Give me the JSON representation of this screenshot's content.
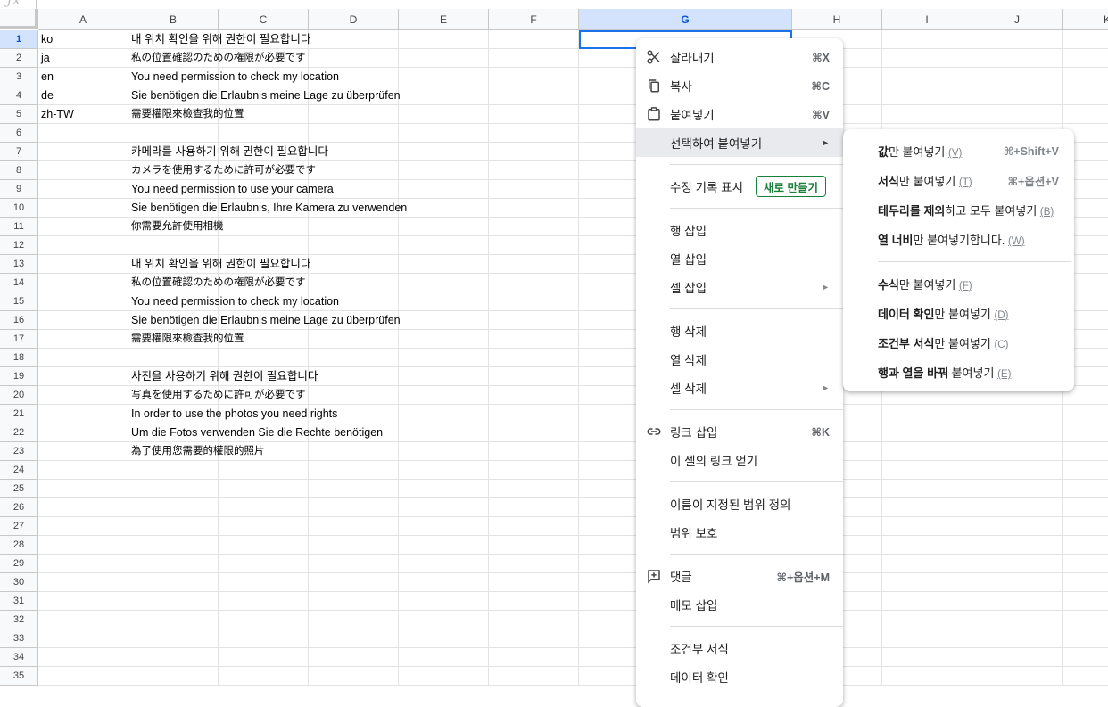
{
  "columns": [
    "A",
    "B",
    "C",
    "D",
    "E",
    "F",
    "G",
    "H",
    "I",
    "J",
    "K"
  ],
  "rows": [
    "1",
    "2",
    "3",
    "4",
    "5",
    "6",
    "7",
    "8",
    "9",
    "10",
    "11",
    "12",
    "13",
    "14",
    "15",
    "16",
    "17",
    "18",
    "19",
    "20",
    "21",
    "22",
    "23",
    "24",
    "25",
    "26",
    "27",
    "28",
    "29",
    "30",
    "31",
    "32",
    "33",
    "34",
    "35"
  ],
  "col_a": {
    "1": "ko",
    "2": "ja",
    "3": "en",
    "4": "de",
    "5": "zh-TW"
  },
  "col_b": {
    "1": "내 위치 확인을 위해 권한이 필요합니다",
    "2": "私の位置確認のための権限が必要です",
    "3": "You need permission to check my location",
    "4": "Sie benötigen die Erlaubnis meine Lage zu überprüfen",
    "5": "需要權限來檢查我的位置",
    "7": "카메라를 사용하기 위해 권한이 필요합니다",
    "8": "カメラを使用するために許可が必要です",
    "9": "You need permission to use your camera",
    "10": "Sie benötigen die Erlaubnis, Ihre Kamera zu verwenden",
    "11": "你需要允許使用相機",
    "13": "내 위치 확인을 위해 권한이 필요합니다",
    "14": "私の位置確認のための権限が必要です",
    "15": "You need permission to check my location",
    "16": "Sie benötigen die Erlaubnis meine Lage zu überprüfen",
    "17": "需要權限來檢查我的位置",
    "19": "사진을 사용하기 위해 권한이 필요합니다",
    "20": "写真を使用するために許可が必要です",
    "21": "In order to use the photos you need rights",
    "22": "Um die Fotos verwenden Sie die Rechte benötigen",
    "23": "為了使用您需要的權限的照片"
  },
  "context_menu": {
    "cut": {
      "label": "잘라내기",
      "shortcut": "⌘X",
      "icon": "scissors-icon"
    },
    "copy": {
      "label": "복사",
      "shortcut": "⌘C",
      "icon": "copy-icon"
    },
    "paste": {
      "label": "붙여넣기",
      "shortcut": "⌘V",
      "icon": "clipboard-icon"
    },
    "paste_special": {
      "label": "선택하여 붙여넣기",
      "arrow": "►"
    },
    "edit_history": {
      "label": "수정 기록 표시",
      "badge": "새로 만들기"
    },
    "insert_row": {
      "label": "행 삽입"
    },
    "insert_col": {
      "label": "열 삽입"
    },
    "insert_cells": {
      "label": "셀 삽입",
      "arrow": "►"
    },
    "delete_row": {
      "label": "행 삭제"
    },
    "delete_col": {
      "label": "열 삭제"
    },
    "delete_cells": {
      "label": "셀 삭제",
      "arrow": "►"
    },
    "insert_link": {
      "label": "링크 삽입",
      "shortcut": "⌘K",
      "icon": "link-icon"
    },
    "get_link": {
      "label": "이 셀의 링크 얻기"
    },
    "named_range": {
      "label": "이름이 지정된 범위 정의"
    },
    "protect_range": {
      "label": "범위 보호"
    },
    "comment": {
      "label": "댓글",
      "shortcut": "⌘+옵션+M",
      "icon": "add-comment-icon"
    },
    "insert_note": {
      "label": "메모 삽입"
    },
    "conditional_format": {
      "label": "조건부 서식"
    },
    "data_validation": {
      "label": "데이터 확인"
    }
  },
  "submenu": {
    "values": {
      "bold": "값",
      "rest": "만 붙여넣기 ",
      "key": "(V)",
      "shortcut": "⌘+Shift+V"
    },
    "format": {
      "bold": "서식",
      "rest": "만 붙여넣기 ",
      "key": "(T)",
      "shortcut": "⌘+옵션+V"
    },
    "no_borders": {
      "bold": "테두리를 제외",
      "rest": "하고 모두 붙여넣기 ",
      "key": "(B)"
    },
    "col_width": {
      "bold": "열 너비",
      "rest": "만 붙여넣기합니다. ",
      "key": "(W)"
    },
    "formula": {
      "bold": "수식",
      "rest": "만 붙여넣기 ",
      "key": "(F)"
    },
    "validation": {
      "bold": "데이터 확인",
      "rest": "만 붙여넣기 ",
      "key": "(D)"
    },
    "cond_format": {
      "bold": "조건부 서식",
      "rest": "만 붙여넣기 ",
      "key": "(C)"
    },
    "transpose": {
      "bold": "행과 열을 바꿔",
      "rest": " 붙여넣기 ",
      "key": "(E)"
    }
  }
}
